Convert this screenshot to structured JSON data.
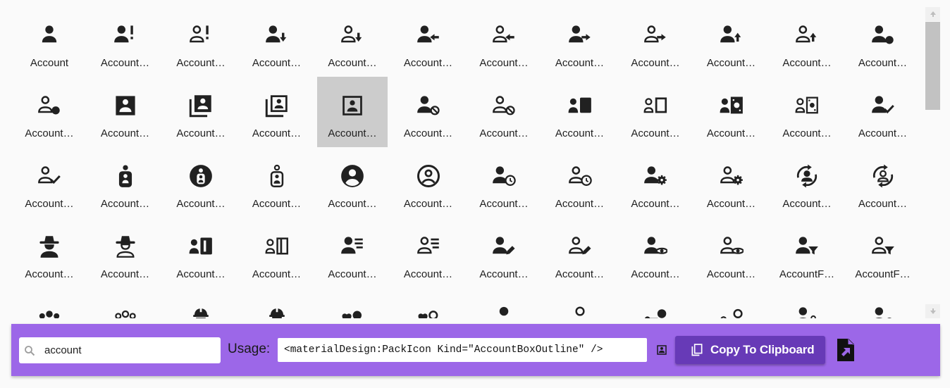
{
  "icons": [
    {
      "label": "Account",
      "glyph": "person",
      "style": "solid",
      "badge": ""
    },
    {
      "label": "Account…",
      "glyph": "person",
      "style": "solid",
      "badge": "exclaim"
    },
    {
      "label": "Account…",
      "glyph": "person",
      "style": "outline",
      "badge": "exclaim"
    },
    {
      "label": "Account…",
      "glyph": "person",
      "style": "solid",
      "badge": "arrow-down"
    },
    {
      "label": "Account…",
      "glyph": "person",
      "style": "outline",
      "badge": "arrow-down"
    },
    {
      "label": "Account…",
      "glyph": "person",
      "style": "solid",
      "badge": "arrow-left"
    },
    {
      "label": "Account…",
      "glyph": "person",
      "style": "outline",
      "badge": "arrow-left"
    },
    {
      "label": "Account…",
      "glyph": "person",
      "style": "solid",
      "badge": "arrow-right"
    },
    {
      "label": "Account…",
      "glyph": "person",
      "style": "outline",
      "badge": "arrow-right"
    },
    {
      "label": "Account…",
      "glyph": "person",
      "style": "solid",
      "badge": "arrow-up"
    },
    {
      "label": "Account…",
      "glyph": "person",
      "style": "outline",
      "badge": "arrow-up"
    },
    {
      "label": "Account…",
      "glyph": "person",
      "style": "solid",
      "badge": "dot"
    },
    {
      "label": "Account…",
      "glyph": "person",
      "style": "outline",
      "badge": "dot"
    },
    {
      "label": "Account…",
      "glyph": "box",
      "style": "solid",
      "badge": ""
    },
    {
      "label": "Account…",
      "glyph": "box-multiple",
      "style": "solid",
      "badge": ""
    },
    {
      "label": "Account…",
      "glyph": "box-multiple",
      "style": "outline",
      "badge": ""
    },
    {
      "label": "Account…",
      "glyph": "box",
      "style": "outline",
      "badge": ""
    },
    {
      "label": "Account…",
      "glyph": "person",
      "style": "solid",
      "badge": "cancel"
    },
    {
      "label": "Account…",
      "glyph": "person",
      "style": "outline",
      "badge": "cancel"
    },
    {
      "label": "Account…",
      "glyph": "card",
      "style": "solid",
      "badge": ""
    },
    {
      "label": "Account…",
      "glyph": "card",
      "style": "outline",
      "badge": ""
    },
    {
      "label": "Account…",
      "glyph": "cash",
      "style": "solid",
      "badge": ""
    },
    {
      "label": "Account…",
      "glyph": "cash",
      "style": "outline",
      "badge": ""
    },
    {
      "label": "Account…",
      "glyph": "person",
      "style": "solid",
      "badge": "check"
    },
    {
      "label": "Account…",
      "glyph": "person",
      "style": "outline",
      "badge": "check"
    },
    {
      "label": "Account…",
      "glyph": "child",
      "style": "solid",
      "badge": ""
    },
    {
      "label": "Account…",
      "glyph": "child-circle",
      "style": "solid",
      "badge": ""
    },
    {
      "label": "Account…",
      "glyph": "child",
      "style": "outline",
      "badge": ""
    },
    {
      "label": "Account…",
      "glyph": "circle",
      "style": "solid",
      "badge": ""
    },
    {
      "label": "Account…",
      "glyph": "circle",
      "style": "outline",
      "badge": ""
    },
    {
      "label": "Account…",
      "glyph": "person",
      "style": "solid",
      "badge": "clock"
    },
    {
      "label": "Account…",
      "glyph": "person",
      "style": "outline",
      "badge": "clock"
    },
    {
      "label": "Account…",
      "glyph": "person",
      "style": "solid",
      "badge": "cog"
    },
    {
      "label": "Account…",
      "glyph": "person",
      "style": "outline",
      "badge": "cog"
    },
    {
      "label": "Account…",
      "glyph": "convert",
      "style": "solid",
      "badge": ""
    },
    {
      "label": "Account…",
      "glyph": "convert",
      "style": "outline",
      "badge": ""
    },
    {
      "label": "Account…",
      "glyph": "cowboy",
      "style": "solid",
      "badge": ""
    },
    {
      "label": "Account…",
      "glyph": "cowboy",
      "style": "outline",
      "badge": ""
    },
    {
      "label": "Account…",
      "glyph": "details",
      "style": "solid",
      "badge": ""
    },
    {
      "label": "Account…",
      "glyph": "details",
      "style": "outline",
      "badge": ""
    },
    {
      "label": "Account…",
      "glyph": "person",
      "style": "solid",
      "badge": "lines"
    },
    {
      "label": "Account…",
      "glyph": "person",
      "style": "outline",
      "badge": "lines"
    },
    {
      "label": "Account…",
      "glyph": "person",
      "style": "solid",
      "badge": "pencil"
    },
    {
      "label": "Account…",
      "glyph": "person",
      "style": "outline",
      "badge": "pencil"
    },
    {
      "label": "Account…",
      "glyph": "person",
      "style": "solid",
      "badge": "eye"
    },
    {
      "label": "Account…",
      "glyph": "person",
      "style": "outline",
      "badge": "eye"
    },
    {
      "label": "AccountF…",
      "glyph": "person",
      "style": "solid",
      "badge": "filter"
    },
    {
      "label": "AccountF…",
      "glyph": "person",
      "style": "outline",
      "badge": "filter"
    },
    {
      "label": "",
      "glyph": "group",
      "style": "solid",
      "badge": ""
    },
    {
      "label": "",
      "glyph": "group",
      "style": "outline",
      "badge": ""
    },
    {
      "label": "",
      "glyph": "hardhat",
      "style": "solid",
      "badge": ""
    },
    {
      "label": "",
      "glyph": "hardhat",
      "style": "outline",
      "badge": ""
    },
    {
      "label": "",
      "glyph": "heart",
      "style": "solid",
      "badge": ""
    },
    {
      "label": "",
      "glyph": "heart",
      "style": "outline",
      "badge": ""
    },
    {
      "label": "",
      "glyph": "tie",
      "style": "solid",
      "badge": ""
    },
    {
      "label": "",
      "glyph": "tie",
      "style": "outline",
      "badge": ""
    },
    {
      "label": "",
      "glyph": "key",
      "style": "solid",
      "badge": ""
    },
    {
      "label": "",
      "glyph": "key",
      "style": "outline",
      "badge": ""
    },
    {
      "label": "",
      "glyph": "person",
      "style": "solid",
      "badge": "lock"
    },
    {
      "label": "",
      "glyph": "person",
      "style": "solid",
      "badge": "dot"
    }
  ],
  "selected_index": 16,
  "search": {
    "value": "account",
    "icon": "magnify-icon"
  },
  "usage": {
    "label": "Usage:",
    "code": "<materialDesign:PackIcon Kind=\"AccountBoxOutline\" />"
  },
  "copy_button": {
    "label": "Copy To Clipboard",
    "icon": "content-copy-icon"
  },
  "export_icon": "file-export-icon",
  "colors": {
    "toolbar": "#9c67e8",
    "button": "#673ab7",
    "selected_tile": "#cccccc",
    "icon": "#212121"
  }
}
